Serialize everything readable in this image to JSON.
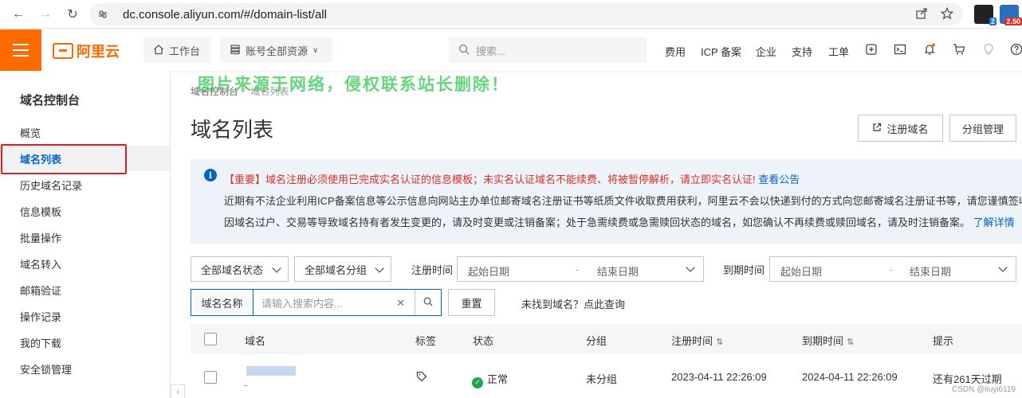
{
  "browser": {
    "url": "dc.console.aliyun.com/#/domain-list/all",
    "ext_badge_1": "2",
    "ext_badge_2": "2.50"
  },
  "topnav": {
    "logo_text": "阿里云",
    "workbench_label": "工作台",
    "resources_label": "账号全部资源",
    "search_placeholder": "搜索...",
    "links": [
      "费用",
      "ICP 备案",
      "企业",
      "支持",
      "工单"
    ]
  },
  "sidebar": {
    "title": "域名控制台",
    "items": [
      {
        "label": "概览"
      },
      {
        "label": "域名列表",
        "active": true
      },
      {
        "label": "历史域名记录"
      },
      {
        "label": "信息模板"
      },
      {
        "label": "批量操作"
      },
      {
        "label": "域名转入"
      },
      {
        "label": "邮箱验证"
      },
      {
        "label": "操作记录"
      },
      {
        "label": "我的下载"
      },
      {
        "label": "安全锁管理"
      }
    ]
  },
  "watermark": "图片来源于网络，侵权联系站长删除！",
  "breadcrumb": [
    "域名控制台",
    "域名列表"
  ],
  "page_title": "域名列表",
  "actions": {
    "register_label": "注册域名",
    "group_label": "分组管理"
  },
  "notice": {
    "line1_red": "【重要】域名注册必须使用已完成实名认证的信息模板；未实名认证域名不能续费、将被暂停解析，请立即实名认证!",
    "line1_link": "查看公告",
    "line2": "近期有不法企业利用ICP备案信息等公示信息向网站主办单位邮寄域名注册证书等纸质文件收取费用获利，阿里云不会以快递到付的方式向您邮寄域名注册证书等，请您谨慎签收！",
    "line3": "因域名过户、交易等导致域名持有者发生变更的，请及时变更或注销备案；处于急需续费或急需赎回状态的域名，如您确认不再续费或赎回域名，请及时注销备案。",
    "line3_link": "了解详情"
  },
  "filters": {
    "status_select": "全部域名状态",
    "group_select": "全部域名分组",
    "reg_time_label": "注册时间",
    "exp_time_label": "到期时间",
    "start_date": "起始日期",
    "end_date": "结束日期",
    "search_prefix": "域名名称",
    "search_placeholder": "请输入搜索内容...",
    "reset_label": "重置",
    "not_found_link": "未找到域名？点此查询"
  },
  "table": {
    "headers": [
      "域名",
      "标签",
      "状态",
      "分组",
      "注册时间",
      "到期时间",
      "提示"
    ],
    "rows": [
      {
        "domain": "",
        "status": "正常",
        "group": "未分组",
        "reg_time": "2023-04-11 22:26:09",
        "exp_time": "2024-04-11 22:26:09",
        "tip": "还有261天过期"
      }
    ]
  },
  "footer_mark": "CSDN @liuyi6119",
  "colors": {
    "brand": "#ff6a00",
    "link": "#0064c8",
    "danger": "#d93026",
    "success": "#1fa64a"
  }
}
